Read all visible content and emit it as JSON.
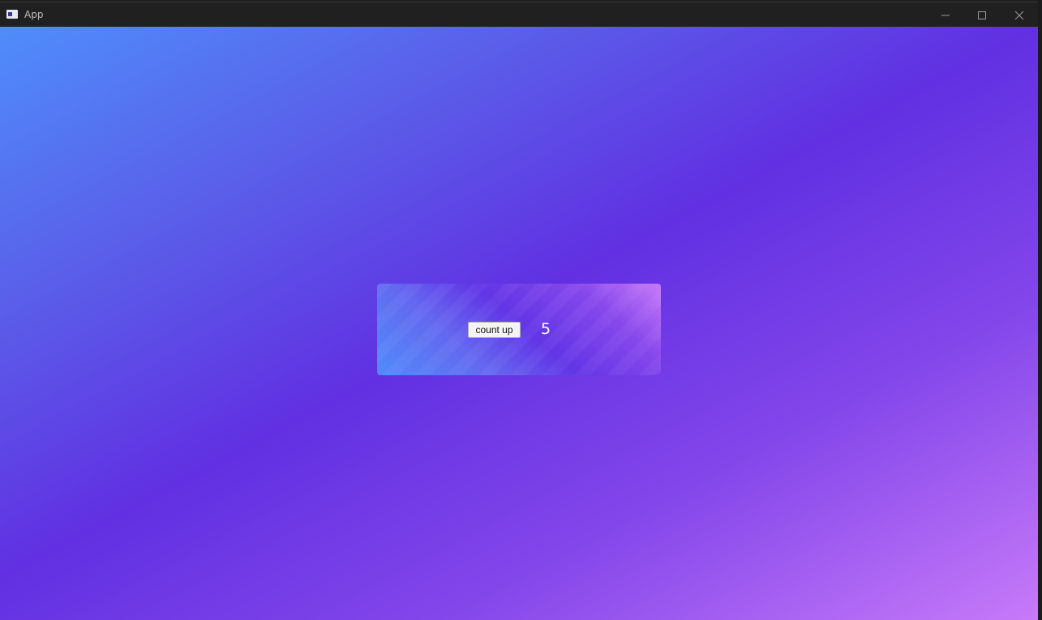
{
  "window": {
    "title": "App",
    "minimize_icon": "minimize-icon",
    "maximize_icon": "maximize-icon",
    "close_icon": "close-icon"
  },
  "counter": {
    "button_label": "count up",
    "value": "5"
  },
  "colors": {
    "gradient_start": "#4f8dfb",
    "gradient_mid": "#6130e2",
    "gradient_end": "#c77af9",
    "titlebar": "#202020"
  }
}
